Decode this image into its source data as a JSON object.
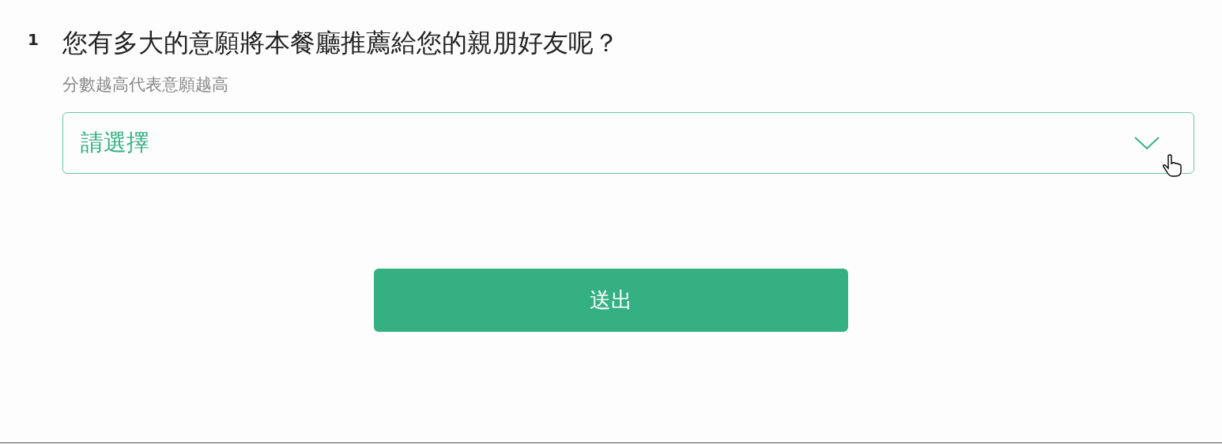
{
  "question": {
    "number": "1",
    "title": "您有多大的意願將本餐廳推薦給您的親朋好友呢？",
    "hint": "分數越高代表意願越高"
  },
  "select": {
    "placeholder": "請選擇"
  },
  "submit_button": {
    "label": "送出"
  }
}
